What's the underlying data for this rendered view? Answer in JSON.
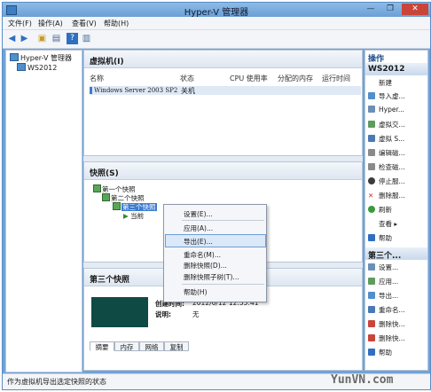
{
  "window": {
    "title": "Hyper-V 管理器",
    "min": "—",
    "max": "❐",
    "close": "✕"
  },
  "menu": [
    "文件(F)",
    "操作(A)",
    "查看(V)",
    "帮助(H)"
  ],
  "toolbar": [
    "back-icon",
    "forward-icon",
    "folder-icon",
    "properties-icon",
    "help-icon",
    "console-icon"
  ],
  "tree": [
    "Hyper-V 管理器",
    "WS2012"
  ],
  "vm_section": {
    "title": "虚拟机(I)",
    "columns": [
      "名称",
      "状态",
      "CPU 使用率",
      "分配的内存",
      "运行时间"
    ],
    "rows": [
      {
        "name": "Windows Server 2003 SP2",
        "state": "关机"
      }
    ]
  },
  "snapshot_section": {
    "title": "快照(S)",
    "items": [
      "第一个快照",
      "第二个快照",
      "第三个快照",
      "当前"
    ]
  },
  "context_menu": [
    "设置(E)...",
    "应用(A)...",
    "导出(E)...",
    "重命名(M)...",
    "删除快照(D)...",
    "删除快照子树(T)...",
    "帮助(H)"
  ],
  "detail_section": {
    "title": "第三个快照",
    "created_label": "创建时间:",
    "created_value": "2012/6/12 12:55:41",
    "notes_label": "说明:",
    "notes_value": "无",
    "tabs": [
      "摘要",
      "内存",
      "网络",
      "复制"
    ]
  },
  "actions": {
    "title": "操作",
    "group1": "WS2012",
    "group1_items": [
      "新建",
      "导入虚...",
      "Hyper...",
      "虚拟交...",
      "虚拟 S...",
      "编辑磁...",
      "检查磁...",
      "停止服...",
      "删除服...",
      "刷新",
      "查看",
      "帮助"
    ],
    "group2": "第三个...",
    "group2_items": [
      "设置...",
      "应用...",
      "导出...",
      "重命名...",
      "删除快...",
      "删除快...",
      "帮助"
    ]
  },
  "status": "作为虚拟机导出选定快照的状态",
  "watermark": "YunVN.com",
  "colors": {
    "accent": "#3b7bd0",
    "title_bg": "#6fa3d8",
    "close": "#c9453a"
  }
}
